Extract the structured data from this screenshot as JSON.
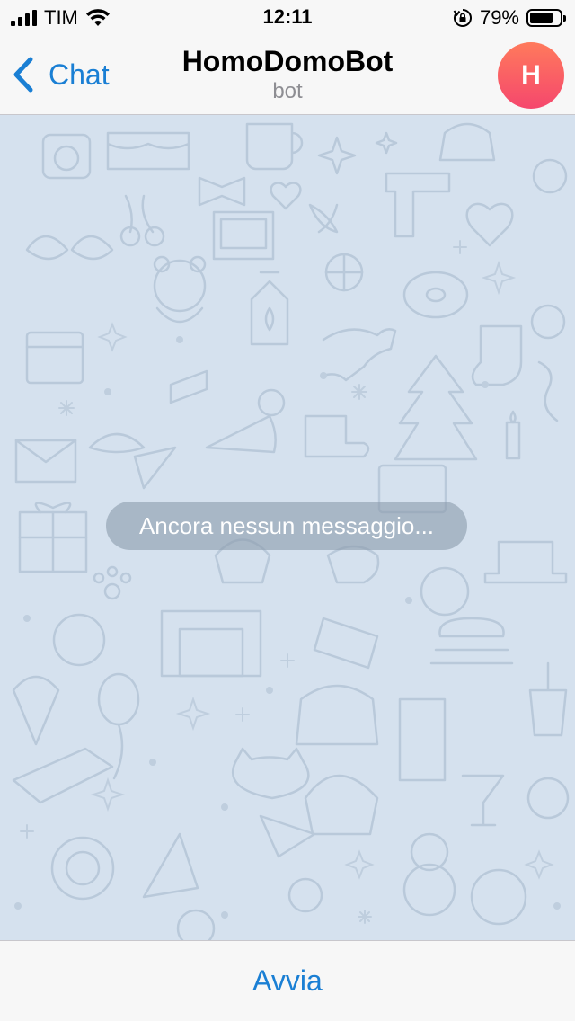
{
  "status_bar": {
    "carrier": "TIM",
    "time": "12:11",
    "battery_percent": "79%",
    "battery_level": 0.79
  },
  "nav": {
    "back_label": "Chat",
    "title": "HomoDomoBot",
    "subtitle": "bot",
    "avatar_initial": "H"
  },
  "chat": {
    "empty_message": "Ancora nessun messaggio..."
  },
  "bottom": {
    "start_label": "Avvia"
  },
  "colors": {
    "accent": "#1a7fd4",
    "chat_background": "#d5e1ee",
    "avatar_gradient_top": "#ff7a5c",
    "avatar_gradient_bottom": "#f5476d"
  }
}
